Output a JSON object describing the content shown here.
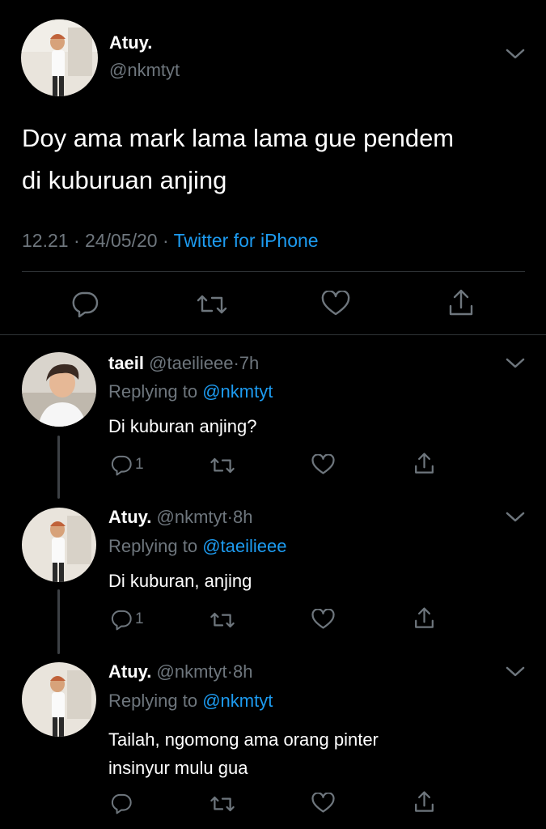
{
  "main_tweet": {
    "display_name": "Atuy.",
    "handle": "@nkmtyt",
    "text_line1": "Doy ama mark lama lama gue pendem",
    "text_line2": "di kuburuan anjing",
    "time": "12.21",
    "date": "24/05/20",
    "source": "Twitter for iPhone",
    "sep": "·"
  },
  "replies": [
    {
      "display_name": "taeil",
      "handle": "@taeilieee",
      "time": "7h",
      "replying_prefix": "Replying to",
      "replying_to": "@nkmtyt",
      "text_line1": "Di kuburan anjing?",
      "text_line2": "",
      "reply_count": "1"
    },
    {
      "display_name": "Atuy.",
      "handle": "@nkmtyt",
      "time": "8h",
      "replying_prefix": "Replying to",
      "replying_to": "@taeilieee",
      "text_line1": "Di kuburan, anjing",
      "text_line2": "",
      "reply_count": "1"
    },
    {
      "display_name": "Atuy.",
      "handle": "@nkmtyt",
      "time": "8h",
      "replying_prefix": "Replying to",
      "replying_to": "@nkmtyt",
      "text_line1": "Tailah, ngomong ama orang pinter",
      "text_line2": "insinyur mulu gua",
      "reply_count": ""
    }
  ],
  "icons": [
    "reply-icon",
    "retweet-icon",
    "like-icon",
    "share-icon",
    "chevron-down-icon"
  ],
  "colors": {
    "background": "#000000",
    "muted": "#6e767d",
    "link": "#1d9bf0",
    "divider": "#2f3336"
  }
}
